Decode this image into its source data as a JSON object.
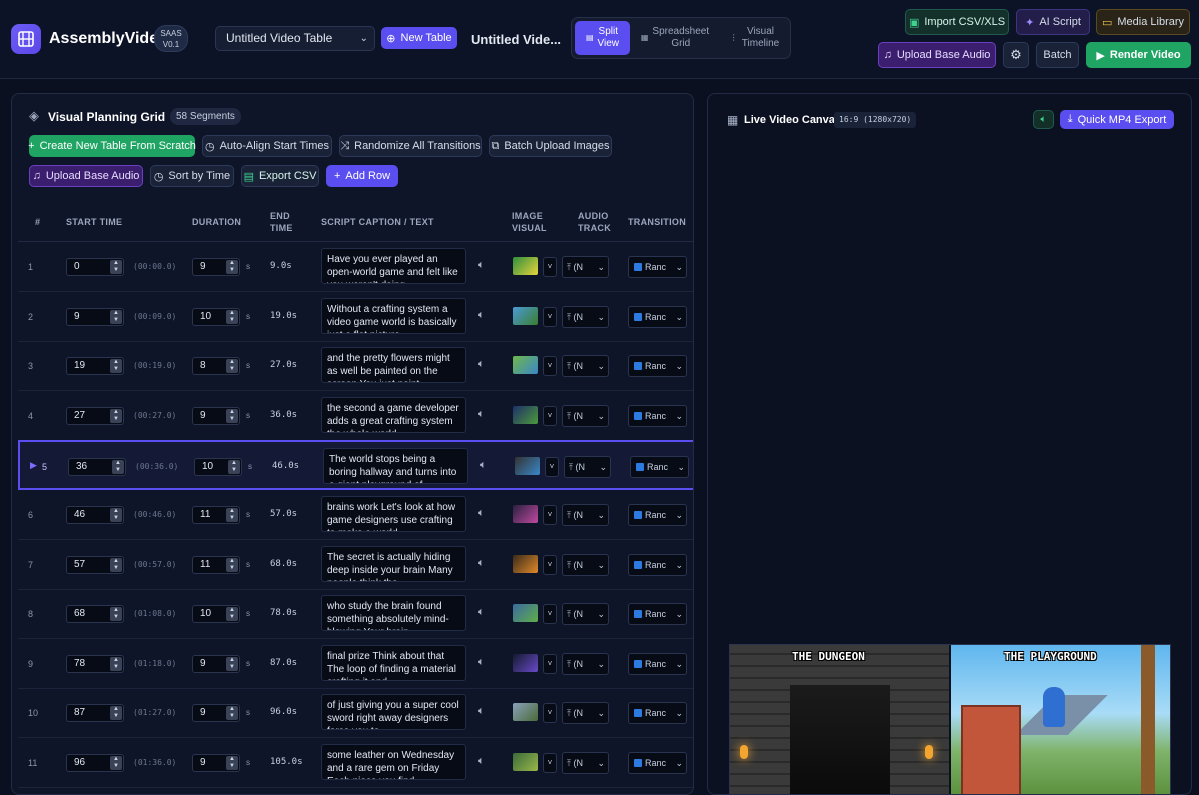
{
  "header": {
    "brand": "AssemblyVideo",
    "badge_line1": "SAAS",
    "badge_line2": "V0.1",
    "table_select": "Untitled Video Table",
    "new_table": "New Table",
    "title_short": "Untitled Vide...",
    "views": [
      {
        "line1": "Split",
        "line2": "View"
      },
      {
        "line1": "Spreadsheet",
        "line2": "Grid"
      },
      {
        "line1": "Visual",
        "line2": "Timeline"
      }
    ],
    "import_csv": "Import CSV/XLS",
    "ai_script": "AI Script",
    "media_library": "Media Library",
    "upload_audio": "Upload Base Audio",
    "batch": "Batch",
    "render": "Render Video"
  },
  "grid": {
    "title": "Visual Planning Grid",
    "segments": "58 Segments",
    "toolbar": {
      "create_table": "Create New Table From Scratch",
      "auto_align": "Auto-Align Start Times",
      "randomize": "Randomize All Transitions",
      "batch_upload": "Batch Upload Images",
      "upload_audio": "Upload Base Audio",
      "sort_time": "Sort by Time",
      "export_csv": "Export CSV",
      "add_row": "Add Row"
    },
    "columns": {
      "num": "#",
      "start": "START TIME",
      "duration": "DURATION",
      "end1": "END",
      "end2": "TIME",
      "caption": "SCRIPT CAPTION / TEXT",
      "image1": "IMAGE",
      "image2": "VISUAL",
      "audio1": "AUDIO",
      "audio2": "TRACK",
      "transition": "TRANSITION"
    },
    "unit": "s",
    "image_select": "˅",
    "audio_select": "(N",
    "transition_select": "Ranc",
    "rows": [
      {
        "n": "1",
        "start": "0",
        "ts": "(00:00.0)",
        "dur": "9",
        "end": "9.0s",
        "caption": "Have you ever played an open-world game and felt like you weren't doing..."
      },
      {
        "n": "2",
        "start": "9",
        "ts": "(00:09.0)",
        "dur": "10",
        "end": "19.0s",
        "caption": "Without a crafting system a video game world is basically just a flat picture..."
      },
      {
        "n": "3",
        "start": "19",
        "ts": "(00:19.0)",
        "dur": "8",
        "end": "27.0s",
        "caption": "and the pretty flowers might as well be painted on the screen You just point..."
      },
      {
        "n": "4",
        "start": "27",
        "ts": "(00:27.0)",
        "dur": "9",
        "end": "36.0s",
        "caption": "the second a game developer adds a great crafting system the whole world..."
      },
      {
        "n": "5",
        "start": "36",
        "ts": "(00:36.0)",
        "dur": "10",
        "end": "46.0s",
        "caption": "The world stops being a boring hallway and turns into a giant playground of..."
      },
      {
        "n": "6",
        "start": "46",
        "ts": "(00:46.0)",
        "dur": "11",
        "end": "57.0s",
        "caption": "brains work Let's look at how game designers use crafting to make a world..."
      },
      {
        "n": "7",
        "start": "57",
        "ts": "(00:57.0)",
        "dur": "11",
        "end": "68.0s",
        "caption": "The secret is actually hiding deep inside your brain Many people think the..."
      },
      {
        "n": "8",
        "start": "68",
        "ts": "(01:08.0)",
        "dur": "10",
        "end": "78.0s",
        "caption": "who study the brain found something absolutely mind-blowing Your brain..."
      },
      {
        "n": "9",
        "start": "78",
        "ts": "(01:18.0)",
        "dur": "9",
        "end": "87.0s",
        "caption": "final prize Think about that The loop of finding a material crafting it and..."
      },
      {
        "n": "10",
        "start": "87",
        "ts": "(01:27.0)",
        "dur": "9",
        "end": "96.0s",
        "caption": "of just giving you a super cool sword right away designers force you to..."
      },
      {
        "n": "11",
        "start": "96",
        "ts": "(01:36.0)",
        "dur": "9",
        "end": "105.0s",
        "caption": "some leather on Wednesday and a rare gem on Friday Each piece you find..."
      }
    ]
  },
  "canvas": {
    "title": "Live Video Canvas",
    "aspect": "16:9 (1280x720)",
    "export": "Quick MP4 Export",
    "left_label": "THE DUNGEON",
    "right_label": "THE PLAYGROUND"
  }
}
